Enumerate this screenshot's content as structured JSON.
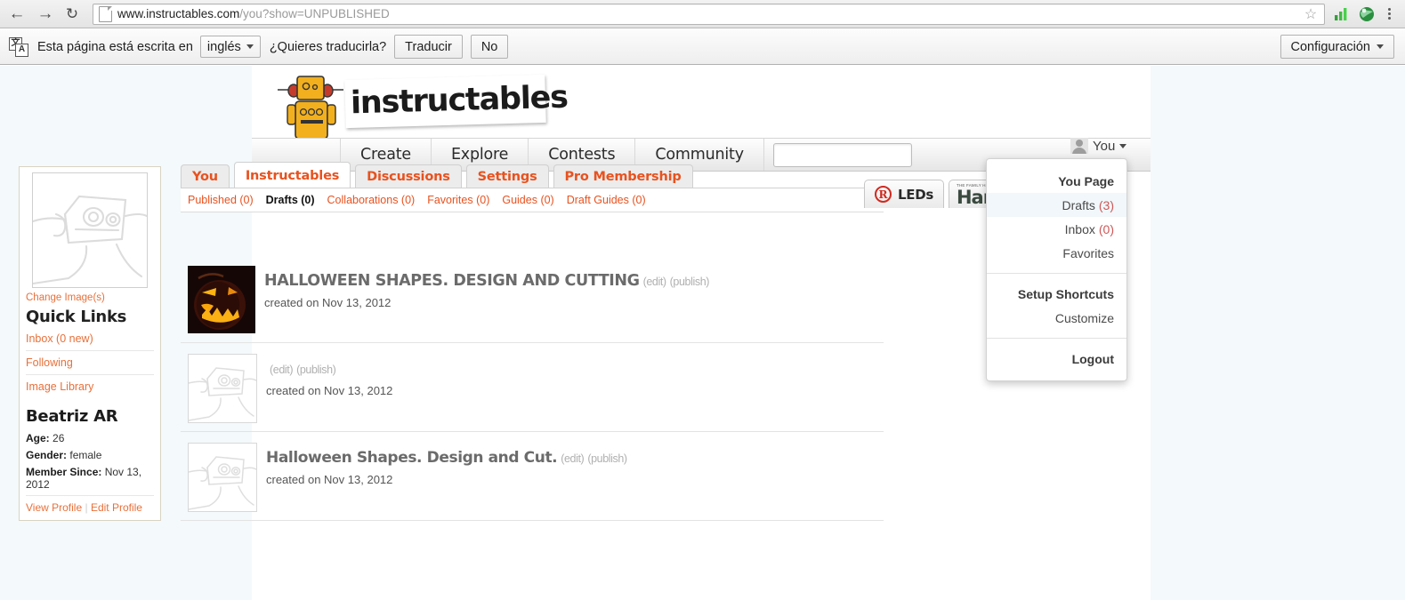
{
  "browser": {
    "back_icon": "back-arrow-icon",
    "forward_icon": "forward-arrow-icon",
    "reload_icon": "reload-icon",
    "url_main": "www.instructables.com",
    "url_rest": "/you?show=UNPUBLISHED",
    "star_icon": "bookmark-star-icon",
    "ext1_icon": "signal-bars-icon",
    "ext2_icon": "globe-icon",
    "menu_icon": "browser-menu-icon"
  },
  "translate_bar": {
    "icon": "translate-icon",
    "message": "Esta página está escrita en",
    "language": "inglés",
    "question": "¿Quieres traducirla?",
    "translate_button": "Traducir",
    "no_button": "No",
    "settings_button": "Configuración"
  },
  "site": {
    "logo_text": "instructables",
    "nav": [
      {
        "label": "Create"
      },
      {
        "label": "Explore"
      },
      {
        "label": "Contests"
      },
      {
        "label": "Community"
      }
    ],
    "search_placeholder": "",
    "search_value": "",
    "contests": [
      {
        "badge": "R",
        "label": "LEDs"
      },
      {
        "tiny": "THE FAMILY HANDYMAN",
        "label": "Hand"
      }
    ]
  },
  "user_menu": {
    "trigger_label": "You",
    "avatar_icon": "user-avatar-icon",
    "caret_icon": "chevron-down-icon",
    "items": [
      {
        "label": "You Page",
        "bold": true,
        "count": ""
      },
      {
        "label": "Drafts",
        "bold": false,
        "count": "(3)",
        "highlight": true
      },
      {
        "label": "Inbox",
        "bold": false,
        "count": "(0)"
      },
      {
        "label": "Favorites",
        "bold": false,
        "count": ""
      }
    ],
    "items2": [
      {
        "label": "Setup Shortcuts",
        "bold": true,
        "count": ""
      },
      {
        "label": "Customize",
        "bold": false,
        "count": ""
      }
    ],
    "items3": [
      {
        "label": "Logout",
        "bold": true,
        "count": ""
      }
    ]
  },
  "sidebar": {
    "avatar_icon": "robot-avatar-image",
    "change_image_link": "Change Image(s)",
    "quick_links_heading": "Quick Links",
    "quick_links": [
      {
        "label": "Inbox (0 new)"
      },
      {
        "label": "Following"
      },
      {
        "label": "Image Library"
      }
    ],
    "user_name": "Beatriz AR",
    "meta": [
      {
        "key": "Age:",
        "value": "26"
      },
      {
        "key": "Gender:",
        "value": "female"
      },
      {
        "key": "Member Since:",
        "value": "Nov 13, 2012"
      }
    ],
    "view_profile": "View Profile",
    "separator": "|",
    "edit_profile": "Edit Profile"
  },
  "main": {
    "tabs": [
      {
        "label": "You",
        "active": false
      },
      {
        "label": "Instructables",
        "active": true
      },
      {
        "label": "Discussions",
        "active": false
      },
      {
        "label": "Settings",
        "active": false
      },
      {
        "label": "Pro Membership",
        "active": false
      }
    ],
    "subtabs": [
      {
        "label": "Published (0)",
        "current": false
      },
      {
        "label": "Drafts (0)",
        "current": true
      },
      {
        "label": "Collaborations (0)",
        "current": false
      },
      {
        "label": "Favorites (0)",
        "current": false
      },
      {
        "label": "Guides (0)",
        "current": false
      },
      {
        "label": "Draft Guides (0)",
        "current": false
      }
    ],
    "drafts": [
      {
        "thumb": "pumpkin-image",
        "title": "HALLOWEEN SHAPES. DESIGN AND CUTTING",
        "edit": "(edit)",
        "publish": "(publish)",
        "date": "created on Nov 13, 2012"
      },
      {
        "thumb": "robot-placeholder-image",
        "title": "",
        "edit": "(edit)",
        "publish": "(publish)",
        "date": "created on Nov 13, 2012"
      },
      {
        "thumb": "robot-placeholder-image",
        "title": "Halloween Shapes. Design and Cut.",
        "edit": "(edit)",
        "publish": "(publish)",
        "date": "created on Nov 13, 2012"
      }
    ]
  },
  "colors": {
    "accent_orange": "#e8521f",
    "link_orange": "#e8703a",
    "page_bg": "#f4f9fb",
    "count_red": "#cf5757"
  }
}
